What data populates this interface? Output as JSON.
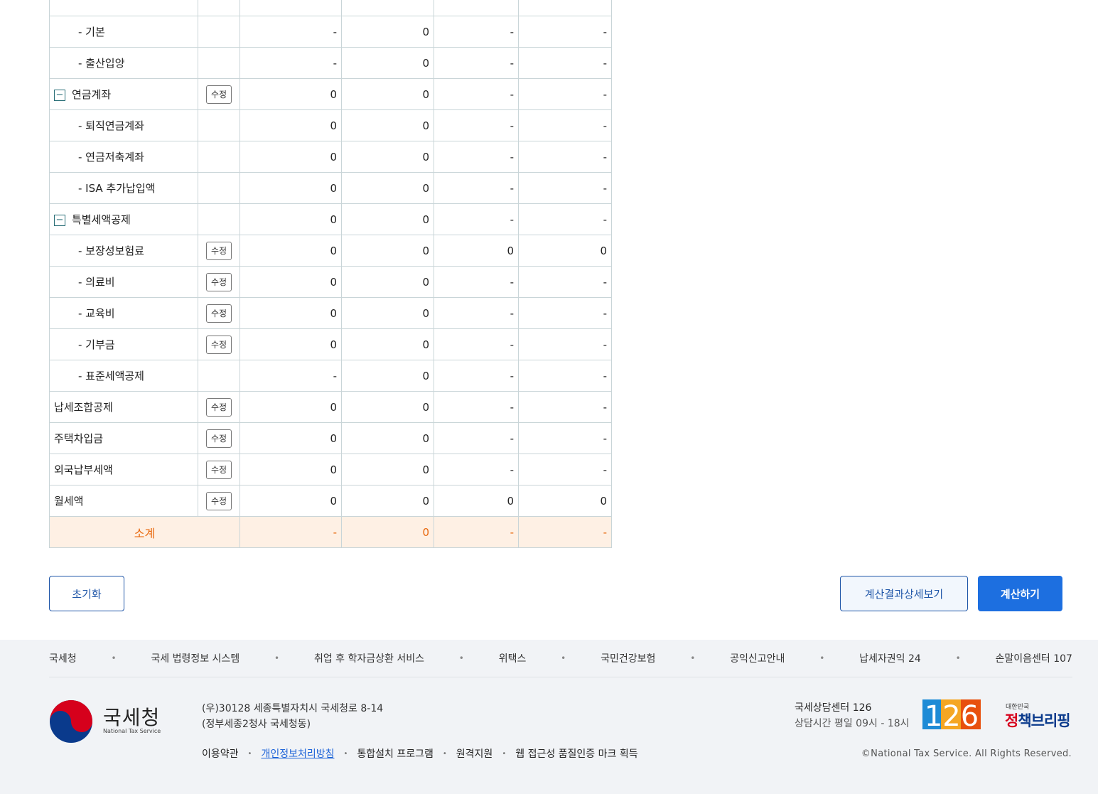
{
  "table": {
    "edit_label": "수정",
    "collapse_symbol": "−",
    "rows": [
      {
        "label": "",
        "indent": false,
        "toggle": false,
        "edit": false,
        "c1": "",
        "c2": "",
        "c3": "",
        "c4": ""
      },
      {
        "label": "- 기본",
        "indent": true,
        "toggle": false,
        "edit": false,
        "c1": "-",
        "c2": "0",
        "c3": "-",
        "c4": "-"
      },
      {
        "label": "- 출산입양",
        "indent": true,
        "toggle": false,
        "edit": false,
        "c1": "-",
        "c2": "0",
        "c3": "-",
        "c4": "-"
      },
      {
        "label": "연금계좌",
        "indent": false,
        "toggle": true,
        "edit": true,
        "c1": "0",
        "c2": "0",
        "c3": "-",
        "c4": "-"
      },
      {
        "label": "- 퇴직연금계좌",
        "indent": true,
        "toggle": false,
        "edit": false,
        "c1": "0",
        "c2": "0",
        "c3": "-",
        "c4": "-"
      },
      {
        "label": "- 연금저축계좌",
        "indent": true,
        "toggle": false,
        "edit": false,
        "c1": "0",
        "c2": "0",
        "c3": "-",
        "c4": "-"
      },
      {
        "label": "- ISA 추가납입액",
        "indent": true,
        "toggle": false,
        "edit": false,
        "c1": "0",
        "c2": "0",
        "c3": "-",
        "c4": "-"
      },
      {
        "label": "특별세액공제",
        "indent": false,
        "toggle": true,
        "edit": false,
        "c1": "0",
        "c2": "0",
        "c3": "-",
        "c4": "-"
      },
      {
        "label": "- 보장성보험료",
        "indent": true,
        "toggle": false,
        "edit": true,
        "c1": "0",
        "c2": "0",
        "c3": "0",
        "c4": "0"
      },
      {
        "label": "- 의료비",
        "indent": true,
        "toggle": false,
        "edit": true,
        "c1": "0",
        "c2": "0",
        "c3": "-",
        "c4": "-"
      },
      {
        "label": "- 교육비",
        "indent": true,
        "toggle": false,
        "edit": true,
        "c1": "0",
        "c2": "0",
        "c3": "-",
        "c4": "-"
      },
      {
        "label": "- 기부금",
        "indent": true,
        "toggle": false,
        "edit": true,
        "c1": "0",
        "c2": "0",
        "c3": "-",
        "c4": "-"
      },
      {
        "label": "- 표준세액공제",
        "indent": true,
        "toggle": false,
        "edit": false,
        "c1": "-",
        "c2": "0",
        "c3": "-",
        "c4": "-"
      },
      {
        "label": "납세조합공제",
        "indent": false,
        "toggle": false,
        "edit": true,
        "c1": "0",
        "c2": "0",
        "c3": "-",
        "c4": "-"
      },
      {
        "label": "주택차입금",
        "indent": false,
        "toggle": false,
        "edit": true,
        "c1": "0",
        "c2": "0",
        "c3": "-",
        "c4": "-"
      },
      {
        "label": "외국납부세액",
        "indent": false,
        "toggle": false,
        "edit": true,
        "c1": "0",
        "c2": "0",
        "c3": "-",
        "c4": "-"
      },
      {
        "label": "월세액",
        "indent": false,
        "toggle": false,
        "edit": true,
        "c1": "0",
        "c2": "0",
        "c3": "0",
        "c4": "0"
      }
    ],
    "subtotal": {
      "label": "소계",
      "c1": "-",
      "c2": "0",
      "c3": "-",
      "c4": "-"
    }
  },
  "actions": {
    "reset": "초기화",
    "detail": "계산결과상세보기",
    "calculate": "계산하기"
  },
  "footer": {
    "links": [
      "국세청",
      "국세 법령정보 시스템",
      "취업 후 학자금상환 서비스",
      "위택스",
      "국민건강보험",
      "공익신고안내",
      "납세자권익 24",
      "손말이음센터 107"
    ],
    "logo_name": "국세청",
    "logo_sub": "National Tax Service",
    "address_line1": "(우)30128 세종특별자치시 국세청로 8-14",
    "address_line2": "(정부세종2청사 국세청동)",
    "policy": [
      "이용약관",
      "개인정보처리방침",
      "통합설치 프로그램",
      "원격지원",
      "웹 접근성 품질인증 마크 획득"
    ],
    "center_title": "국세상담센터 126",
    "center_hours": "상담시간 평일 09시 - 18시",
    "badge_number": "126",
    "briefing_top": "대한민국",
    "briefing_red": "정",
    "briefing_rest": "책브리핑",
    "copyright": "©National Tax Service. All Rights Reserved."
  },
  "colors": {
    "primary": "#1d6fe0",
    "subtotal_bg": "#fef0e4",
    "subtotal_text": "#e8660a",
    "footer_bg": "#f1f3f6",
    "border": "#c9d5d8"
  }
}
